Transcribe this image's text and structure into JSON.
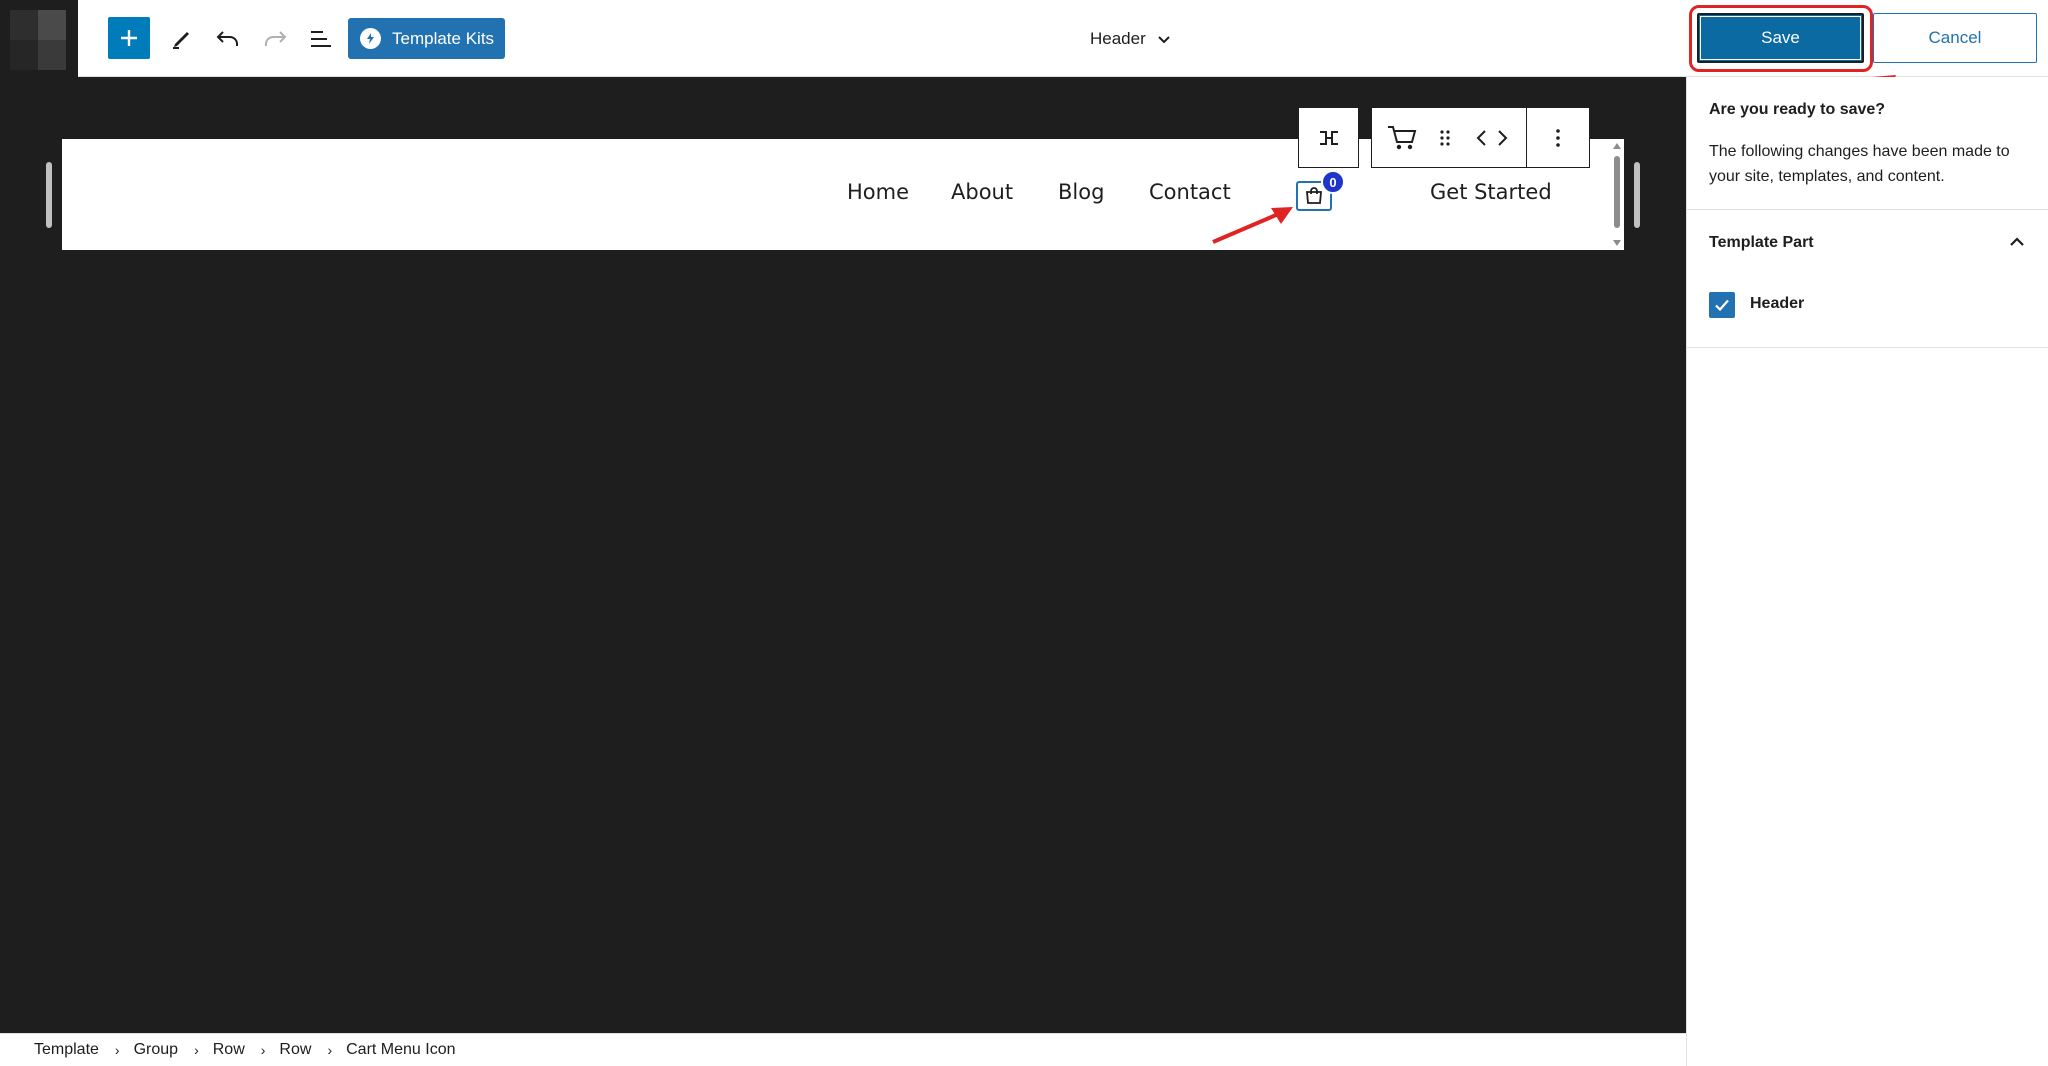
{
  "topbar": {
    "kits_label": "Template Kits",
    "document_title": "Header",
    "save_label": "Save",
    "cancel_label": "Cancel"
  },
  "canvas": {
    "nav": [
      "Home",
      "About",
      "Blog",
      "Contact"
    ],
    "cart_count": "0",
    "cta_label": "Get Started"
  },
  "breadcrumb": [
    "Template",
    "Group",
    "Row",
    "Row",
    "Cart Menu Icon"
  ],
  "sidebar": {
    "heading": "Are you ready to save?",
    "description": "The following changes have been made to your site, templates, and content.",
    "panel_title": "Template Part",
    "entity_label": "Header",
    "entity_checked": true
  },
  "colors": {
    "accent": "#2271b1",
    "canvas_bg": "#1e1e1e",
    "annotation": "#e02424",
    "badge": "#1d35c9"
  },
  "icons": [
    "plus-icon",
    "pen-icon",
    "undo-icon",
    "redo-icon",
    "list-view-icon",
    "template-kits-icon",
    "chevron-down-icon",
    "parent-block-icon",
    "cart-icon",
    "drag-handle-icon",
    "move-arrows-icon",
    "more-options-icon",
    "chevron-up-icon",
    "checkmark-icon"
  ]
}
